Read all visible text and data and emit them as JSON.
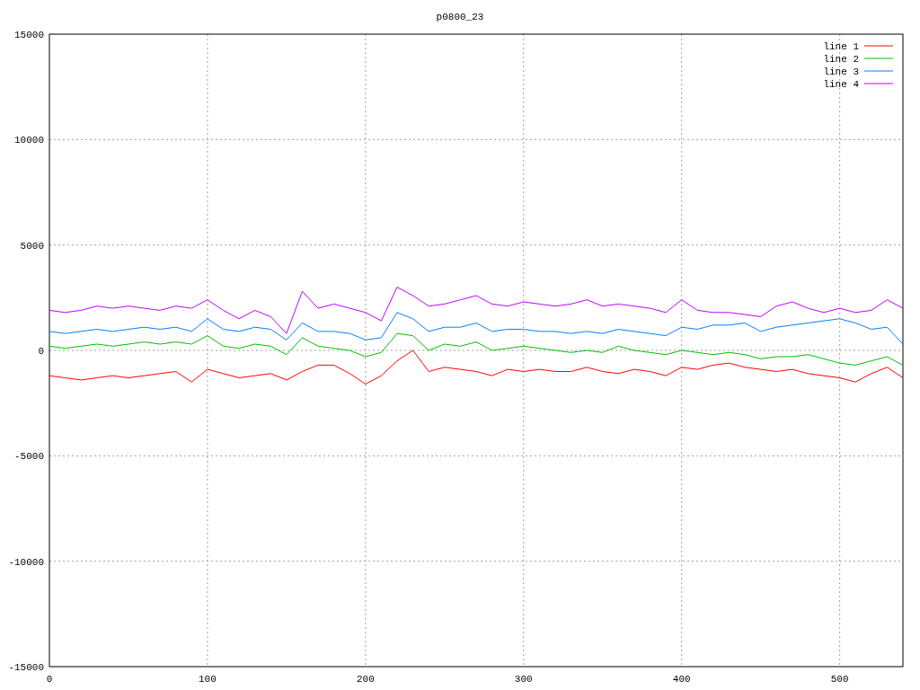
{
  "chart_data": {
    "type": "line",
    "title": "p0800_23",
    "grid": true,
    "legend": true,
    "xlim": [
      0,
      540
    ],
    "ylim": [
      -15000,
      15000
    ],
    "xticks": [
      0,
      100,
      200,
      300,
      400,
      500
    ],
    "yticks": [
      -15000,
      -10000,
      -5000,
      0,
      5000,
      10000,
      15000
    ],
    "x": [
      0,
      10,
      20,
      30,
      40,
      50,
      60,
      70,
      80,
      90,
      100,
      110,
      120,
      130,
      140,
      150,
      160,
      170,
      180,
      190,
      200,
      210,
      220,
      230,
      240,
      250,
      260,
      270,
      280,
      290,
      300,
      310,
      320,
      330,
      340,
      350,
      360,
      370,
      380,
      390,
      400,
      410,
      420,
      430,
      440,
      450,
      460,
      470,
      480,
      490,
      500,
      510,
      520,
      530,
      540
    ],
    "series": [
      {
        "name": "line 1",
        "color": "#ff0000",
        "values": [
          -1200,
          -1300,
          -1400,
          -1300,
          -1200,
          -1300,
          -1200,
          -1100,
          -1000,
          -1500,
          -900,
          -1100,
          -1300,
          -1200,
          -1100,
          -1400,
          -1000,
          -700,
          -700,
          -1100,
          -1600,
          -1200,
          -500,
          0,
          -1000,
          -800,
          -900,
          -1000,
          -1200,
          -900,
          -1000,
          -900,
          -1000,
          -1000,
          -800,
          -1000,
          -1100,
          -900,
          -1000,
          -1200,
          -800,
          -900,
          -700,
          -600,
          -800,
          -900,
          -1000,
          -900,
          -1100,
          -1200,
          -1300,
          -1500,
          -1100,
          -800,
          -1300
        ]
      },
      {
        "name": "line 2",
        "color": "#00c000",
        "values": [
          200,
          100,
          200,
          300,
          200,
          300,
          400,
          300,
          400,
          300,
          700,
          200,
          100,
          300,
          200,
          -200,
          600,
          200,
          100,
          0,
          -300,
          -100,
          800,
          700,
          0,
          300,
          200,
          400,
          0,
          100,
          200,
          100,
          0,
          -100,
          0,
          -100,
          200,
          0,
          -100,
          -200,
          0,
          -100,
          -200,
          -100,
          -200,
          -400,
          -300,
          -300,
          -200,
          -400,
          -600,
          -700,
          -500,
          -300,
          -700
        ]
      },
      {
        "name": "line 3",
        "color": "#0080ff",
        "values": [
          900,
          800,
          900,
          1000,
          900,
          1000,
          1100,
          1000,
          1100,
          900,
          1500,
          1000,
          900,
          1100,
          1000,
          500,
          1300,
          900,
          900,
          800,
          500,
          600,
          1800,
          1500,
          900,
          1100,
          1100,
          1300,
          900,
          1000,
          1000,
          900,
          900,
          800,
          900,
          800,
          1000,
          900,
          800,
          700,
          1100,
          1000,
          1200,
          1200,
          1300,
          900,
          1100,
          1200,
          1300,
          1400,
          1500,
          1300,
          1000,
          1100,
          300
        ]
      },
      {
        "name": "line 4",
        "color": "#c000ff",
        "values": [
          1900,
          1800,
          1900,
          2100,
          2000,
          2100,
          2000,
          1900,
          2100,
          2000,
          2400,
          1900,
          1500,
          1900,
          1600,
          800,
          2800,
          2000,
          2200,
          2000,
          1800,
          1400,
          3000,
          2600,
          2100,
          2200,
          2400,
          2600,
          2200,
          2100,
          2300,
          2200,
          2100,
          2200,
          2400,
          2100,
          2200,
          2100,
          2000,
          1800,
          2400,
          1900,
          1800,
          1800,
          1700,
          1600,
          2100,
          2300,
          2000,
          1800,
          2000,
          1800,
          1900,
          2400,
          2000
        ]
      }
    ]
  }
}
